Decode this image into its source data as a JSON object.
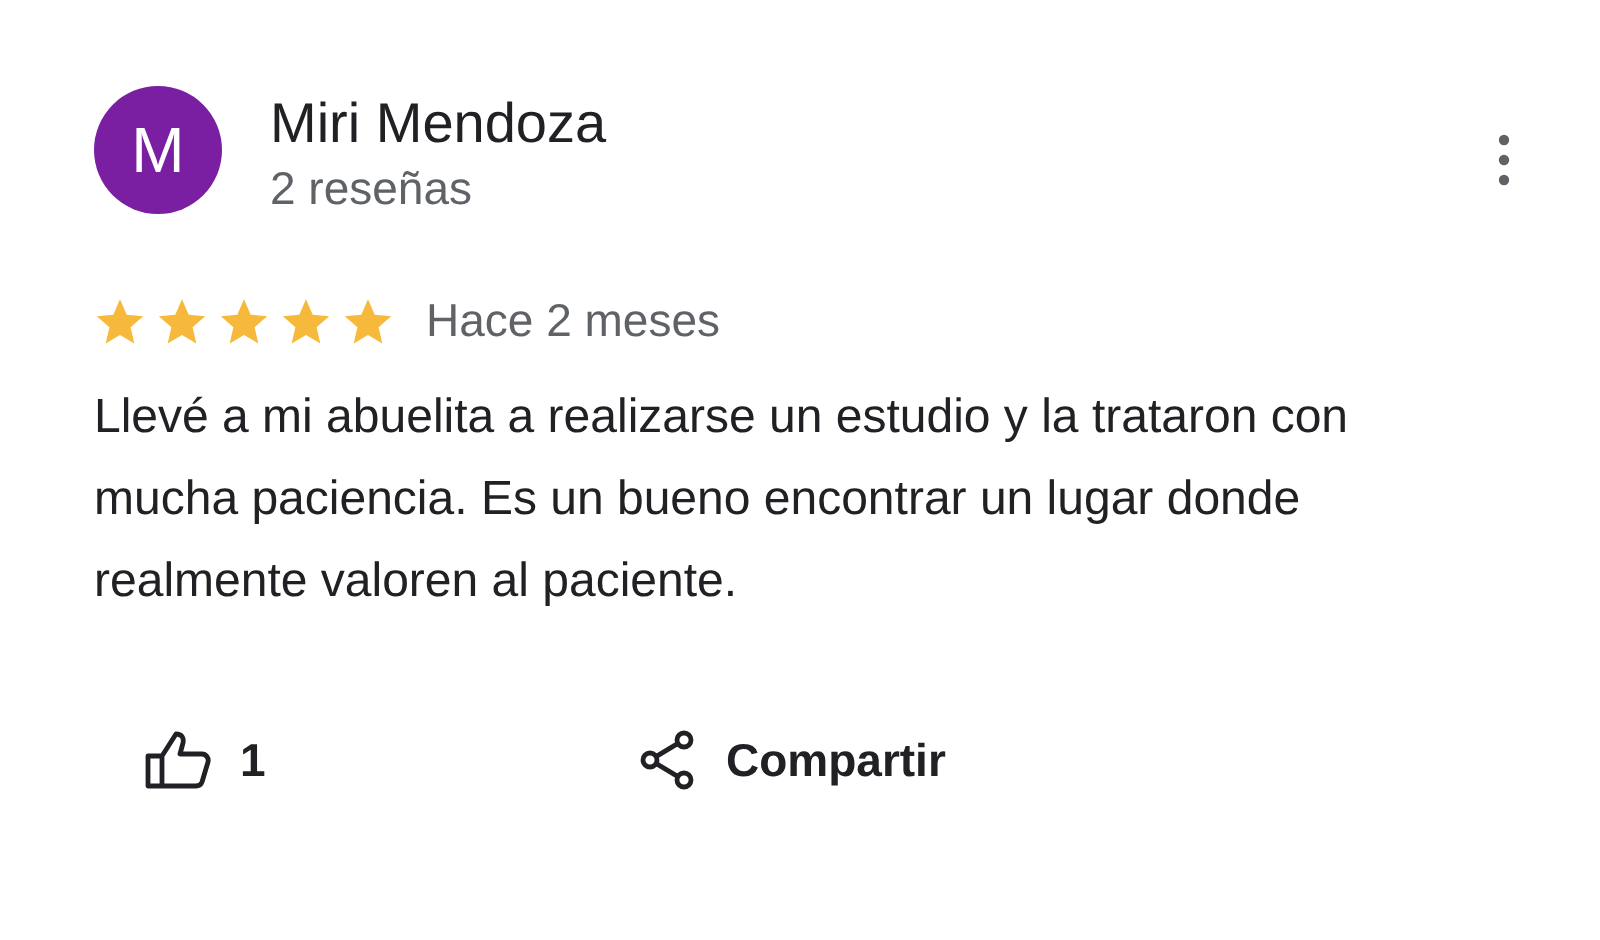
{
  "review": {
    "avatar_letter": "M",
    "author": "Miri Mendoza",
    "author_meta": "2 reseñas",
    "stars": 5,
    "time": "Hace 2 meses",
    "text": "Llevé a mi abuelita a realizarse un estudio y la trataron con mucha paciencia. Es un bueno encontrar un lugar donde realmente valoren al paciente."
  },
  "actions": [
    {
      "kind": "like",
      "label": "1"
    },
    {
      "kind": "share",
      "label": "Compartir"
    }
  ]
}
